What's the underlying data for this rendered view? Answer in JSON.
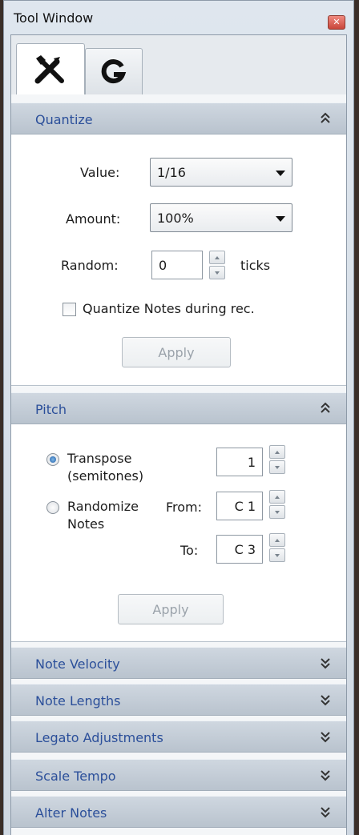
{
  "window": {
    "title": "Tool Window",
    "close_glyph": "✕"
  },
  "tabs": [
    {
      "icon": "tools-icon",
      "active": true
    },
    {
      "icon": "g-icon",
      "active": false
    }
  ],
  "quantize": {
    "header": "Quantize",
    "value_label": "Value:",
    "value": "1/16",
    "amount_label": "Amount:",
    "amount": "100%",
    "random_label": "Random:",
    "random_value": "0",
    "random_unit": "ticks",
    "during_rec_label": "Quantize Notes during rec.",
    "during_rec_checked": false,
    "apply_label": "Apply"
  },
  "pitch": {
    "header": "Pitch",
    "transpose_label_1": "Transpose",
    "transpose_label_2": "(semitones)",
    "transpose_selected": true,
    "transpose_value": "1",
    "randomize_label_1": "Randomize",
    "randomize_label_2": "Notes",
    "from_label": "From:",
    "from_value": "C 1",
    "to_label": "To:",
    "to_value": "C 3",
    "apply_label": "Apply"
  },
  "collapsed_sections": [
    {
      "label": "Note Velocity"
    },
    {
      "label": "Note Lengths"
    },
    {
      "label": "Legato Adjustments"
    },
    {
      "label": "Scale Tempo"
    },
    {
      "label": "Alter Notes"
    }
  ],
  "colors": {
    "header_text": "#2b4f9a",
    "close_button": "#c9463a",
    "radio_selected": "#1f5fa8"
  }
}
